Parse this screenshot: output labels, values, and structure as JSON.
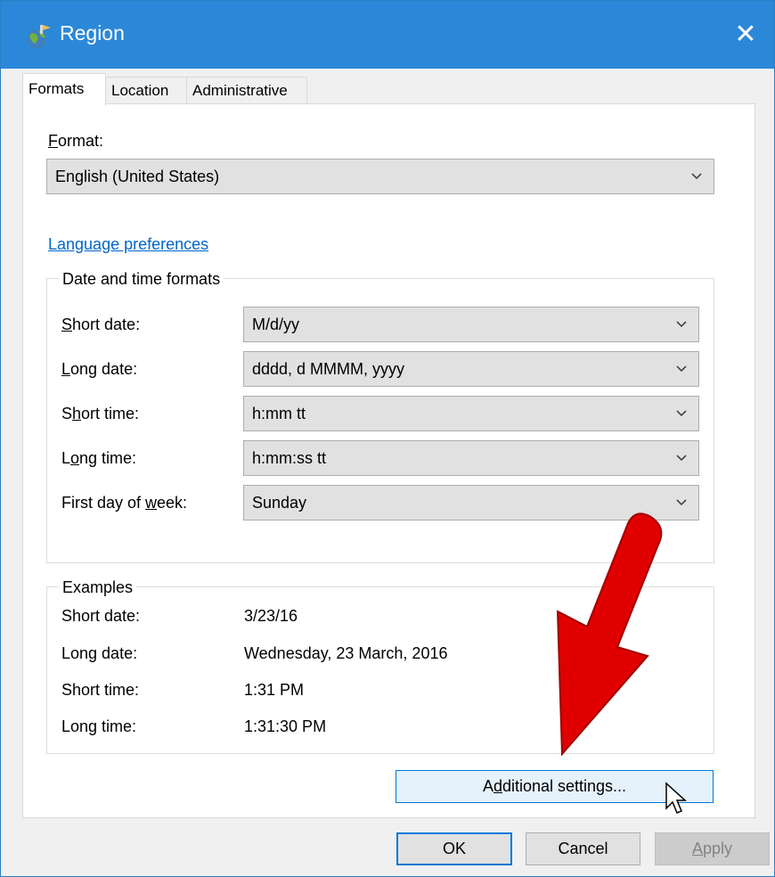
{
  "window": {
    "title": "Region",
    "close_glyph": "✕"
  },
  "tabs": [
    {
      "label": "Formats",
      "active": true
    },
    {
      "label": "Location",
      "active": false
    },
    {
      "label": "Administrative",
      "active": false
    }
  ],
  "format": {
    "label_mnemonic": "F",
    "label_rest": "ormat:",
    "selected": "English (United States)"
  },
  "language_link": "Language preferences",
  "date_time_formats": {
    "title": "Date and time formats",
    "rows": [
      {
        "pre": "",
        "mnemonic": "S",
        "post": "hort date:",
        "value": "M/d/yy"
      },
      {
        "pre": "",
        "mnemonic": "L",
        "post": "ong date:",
        "value": "dddd, d MMMM, yyyy"
      },
      {
        "pre": "S",
        "mnemonic": "h",
        "post": "ort time:",
        "value": "h:mm tt"
      },
      {
        "pre": "L",
        "mnemonic": "o",
        "post": "ng time:",
        "value": "h:mm:ss tt"
      },
      {
        "pre": "First day of ",
        "mnemonic": "w",
        "post": "eek:",
        "value": "Sunday"
      }
    ]
  },
  "examples": {
    "title": "Examples",
    "rows": [
      {
        "label": "Short date:",
        "value": "3/23/16"
      },
      {
        "label": "Long date:",
        "value": "Wednesday, 23 March, 2016"
      },
      {
        "label": "Short time:",
        "value": "1:31 PM"
      },
      {
        "label": "Long time:",
        "value": "1:31:30 PM"
      }
    ]
  },
  "buttons": {
    "additional_pre": "A",
    "additional_mnemonic": "d",
    "additional_post": "ditional settings...",
    "ok": "OK",
    "cancel": "Cancel",
    "apply_mnemonic": "A",
    "apply_rest": "pply"
  },
  "colors": {
    "titlebar": "#2b88d8",
    "link": "#0066cc",
    "arrow": "#e00000",
    "focus": "#0078d7"
  },
  "icons": [
    "region-globe-icon",
    "close-icon",
    "chevron-down-icon",
    "red-arrow-icon",
    "mouse-pointer-icon"
  ]
}
